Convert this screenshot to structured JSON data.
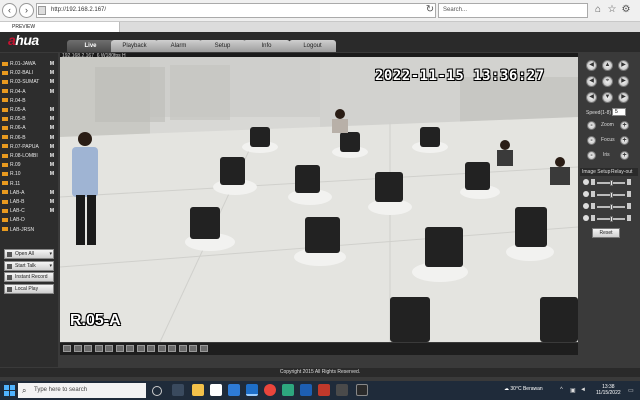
{
  "browser": {
    "address": "http://192.168.2.167/",
    "search_placeholder": "Search...",
    "tab_label": "PREVIEW",
    "window_min": "—",
    "window_max": "□",
    "window_close": "✕"
  },
  "app": {
    "logo_mark": "a",
    "logo_text": "hua",
    "tabs": [
      "Live",
      "Playback",
      "Alarm",
      "Setup",
      "Info",
      "Logout"
    ],
    "active_tab": "Live",
    "copyright": "Copyright 2015 All Rights Reserved."
  },
  "channels": [
    {
      "label": "R.01-JAWA",
      "marker": "M"
    },
    {
      "label": "R.02-BALI",
      "marker": "M"
    },
    {
      "label": "R.03-SUMAT",
      "marker": "M"
    },
    {
      "label": "R.04-A",
      "marker": "M"
    },
    {
      "label": "R.04-B",
      "marker": ""
    },
    {
      "label": "R.05-A",
      "marker": "M"
    },
    {
      "label": "R.05-B",
      "marker": "M"
    },
    {
      "label": "R.06-A",
      "marker": "M"
    },
    {
      "label": "R.06-B",
      "marker": "M"
    },
    {
      "label": "R.07-PAPUA",
      "marker": "M"
    },
    {
      "label": "R.08-LOMBI",
      "marker": "M"
    },
    {
      "label": "R.09",
      "marker": "M"
    },
    {
      "label": "R.10",
      "marker": "M"
    },
    {
      "label": "R.11",
      "marker": ""
    },
    {
      "label": "LAB-A",
      "marker": "M"
    },
    {
      "label": "LAB-B",
      "marker": "M"
    },
    {
      "label": "LAB-C",
      "marker": "M"
    },
    {
      "label": "LAB-D",
      "marker": ""
    },
    {
      "label": "LAB-JRSN",
      "marker": ""
    }
  ],
  "left_buttons": [
    "Open All",
    "Start Talk",
    "Instant Record",
    "Local Play"
  ],
  "video": {
    "cam_info": "192.168.2.167_6 W180fps H",
    "timestamp": "2022-11-15 13:36:27",
    "camera_label": "R.05-A"
  },
  "ptz": {
    "speed_label": "Speed(1-8)",
    "speed_value": "5",
    "zoom_label": "Zoom",
    "focus_label": "Focus",
    "iris_label": "Iris",
    "image_setup_label": "Image Setup",
    "relay_label": "Relay-out",
    "reset_label": "Reset",
    "minus": "-",
    "plus": "+",
    "arrows": [
      "◀",
      "▲",
      "▶",
      "◀",
      "▶",
      "◀",
      "▼",
      "▶"
    ],
    "center": "⌖"
  },
  "image_setup_levels": [
    0.5,
    0.5,
    0.5,
    0.5
  ],
  "taskbar": {
    "search_placeholder": "Type here to search",
    "weather_temp": "30°C",
    "weather_desc": "Berawan",
    "time": "13:38",
    "date": "11/15/2022"
  },
  "colors": {
    "brand_red": "#c41230",
    "channel_icon": "#e89a1f",
    "taskbar": "#1f2b3a"
  }
}
